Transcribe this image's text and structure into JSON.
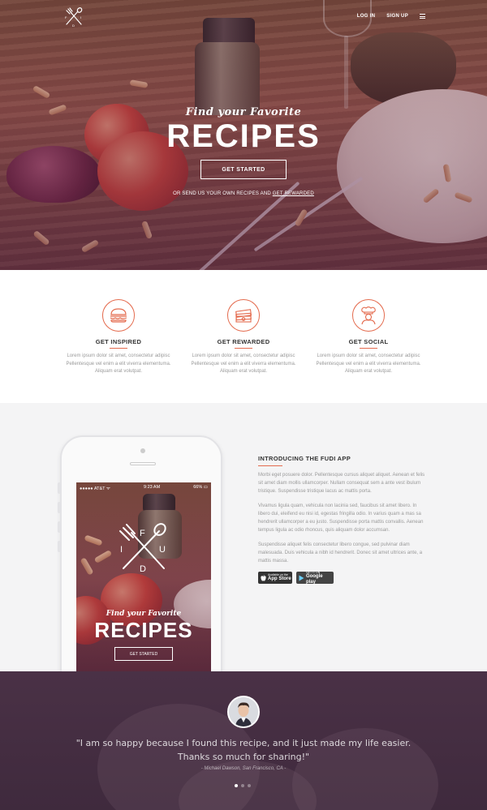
{
  "nav": {
    "login": "LOG IN",
    "signup": "SIGN UP",
    "menu_icon": "hamburger-menu-icon",
    "logo_icon": "crossed-fork-spoon-logo-icon"
  },
  "hero": {
    "subtitle": "Find your Favorite",
    "title": "RECIPES",
    "cta": "GET STARTED",
    "note_prefix": "OR SEND US YOUR OWN RECIPES AND ",
    "note_link": "GET REWARDED"
  },
  "features": [
    {
      "icon": "burger-icon",
      "title": "GET INSPIRED",
      "text": "Lorem ipsum dolor sit amet, consectetur adipisc Pellentesque vel enim a elit viverra elementuma. Aliquam erat volutpat."
    },
    {
      "icon": "cash-stack-icon",
      "title": "GET REWARDED",
      "text": "Lorem ipsum dolor sit amet, consectetur adipisc Pellentesque vel enim a elit viverra elementuma. Aliquam erat volutpat."
    },
    {
      "icon": "chef-icon",
      "title": "GET SOCIAL",
      "text": "Lorem ipsum dolor sit amet, consectetur adipisc Pellentesque vel enim a elit viverra elementuma. Aliquam erat volutpat."
    }
  ],
  "app": {
    "heading": "INTRODUCING THE FUDI APP",
    "paragraphs": [
      "Morbi eget posuere dolor. Pellentesque cursus aliquet aliquet. Aenean et felis sit amet diam mollis ullamcorper. Nullam consequat sem a ante vest ibulum tristique. Suspendisse tristique lacus ac mattis porta.",
      "Vivamus ligula quam, vehicula non lacinia sed, faucibus sit amet libero. In libero dui, eleifend eu nisi id, egestas fringilla odio. In varius quam a mas sa hendrerit ullamcorper a eu justo. Suspendisse porta mattis convallis. Aenean tempus ligula ac odio rhoncus, quis aliquam dolor accumsan.",
      "Suspendisse aliquet felis consectetur libero congue, sed pulvinar diam malesuada. Duis vehicula a nibh id hendrerit. Donec sit amet ultrices ante, a mattis massa."
    ],
    "appstore_small": "Available on the",
    "appstore_big": "App Store",
    "googleplay_small": "GET IT ON",
    "googleplay_big": "Google play",
    "phone": {
      "carrier": "●●●●● AT&T ᯤ",
      "time": "9:23 AM",
      "battery": "66%",
      "logo_letters": [
        "F",
        "I",
        "U",
        "D"
      ],
      "subtitle": "Find your Favorite",
      "title": "RECIPES",
      "cta": "GET STARTED"
    }
  },
  "testimonial": {
    "quote_line1": "\"I am so happy because I found this recipe, and it just made my life easier.",
    "quote_line2": "Thanks  so much for sharing!\"",
    "cite": "- Michael Dawson, San Francisco, CA -",
    "active_slide": 1,
    "slide_count": 3
  },
  "colors": {
    "accent": "#e46b4e",
    "testimonial_bg": "#4a3146"
  }
}
